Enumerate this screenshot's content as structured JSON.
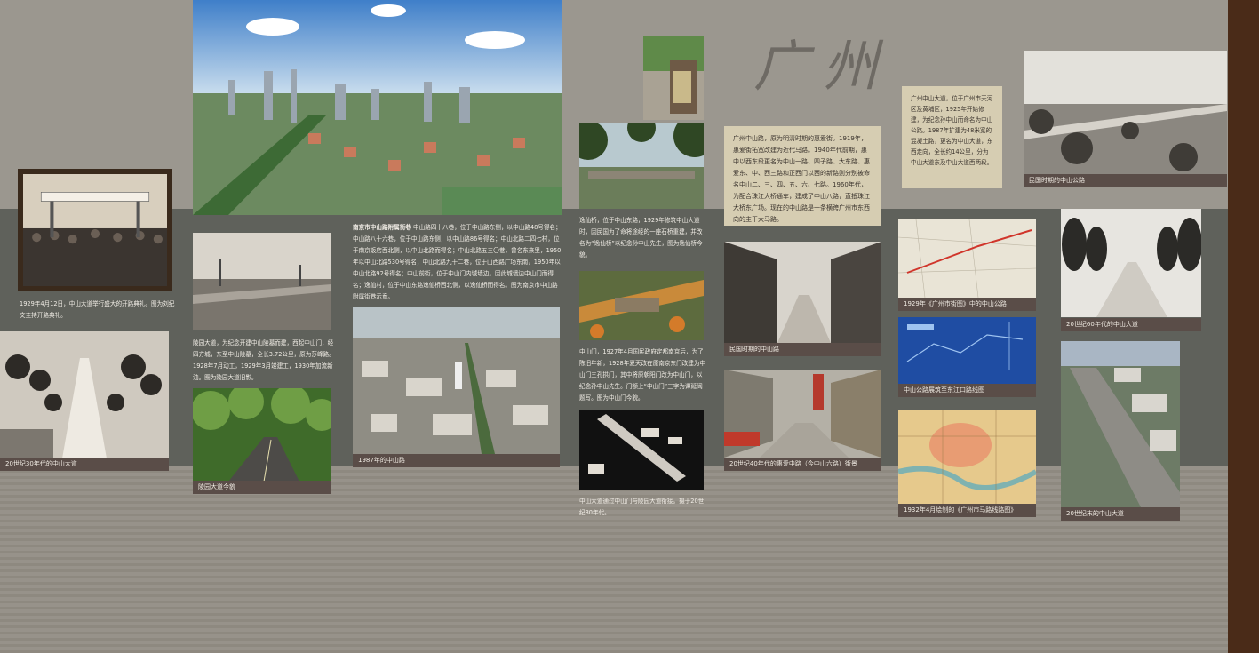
{
  "title": "广州",
  "captions": {
    "c1929": "1929年4月12日，中山大道举行盛大的开路典礼。图为刘纪文主持开路典礼。",
    "c20s30": "20世纪30年代的中山大道",
    "lingyuan": "陵园大道今貌",
    "c1987": "1987年的中山路",
    "c1930s_note": "中山大道通过中山门与陵园大道衔接。摄于20世纪30年代。",
    "minguo_zs": "民国时期的中山路",
    "huiaiton": "20世纪40年代的惠爱中路（今中山六路）街景",
    "map1929": "1929年《广州市街图》中的中山公路",
    "blueprint": "中山公路展筑至东江口路线图",
    "map1932": "1932年4月绘制的《广州市马路线路图》",
    "minguo_gl": "民国时期的中山公路",
    "c60s": "20世纪60年代的中山大道",
    "c_end": "20世纪末的中山大道"
  },
  "texts": {
    "nanjing_title": "南京市中山路附属街巷",
    "nanjing_body": "中山路四十八巷，位于中山路东侧，以中山路48号得名；中山路八十六巷，位于中山路东侧，以中山路86号得名；中山北路二四七村，位于南京饭店西北侧，以中山北路而得名；中山北路五三〇巷，曾名东来里，1950年以中山北路530号得名；中山北路九十二巷，位于山西路广场东南，1950年以中山北路92号得名；中山前街，位于中山门内城墙边，因此城墙边中山门而得名；逸仙村，位于中山东路逸仙桥西北侧，以逸仙桥而得名。图为南京市中山路附属街巷示意。",
    "lingyuan_body": "陵园大道，为纪念开建中山陵墓而建，西起中山门，经四方城，东至中山陵墓，全长3.72公里，原为莎峰路。1928年7月动工，1929年3月竣建工，1930年加流新油。图为陵园大道旧影。",
    "yixian_body": "逸仙桥，位于中山东路，1929年修筑中山大道时，因民国为了命将途经的一座石桥重建，并改名为“逸仙桥”以纪念孙中山先生，图为逸仙桥今貌。",
    "zhongshanmen_body": "中山门，1927年4月国民政府定都南京后，为了陈旧年新，1928年夏天改在原南京东门改建为中山门三孔拱门，其中将原朝阳门改为中山门，以纪念孙中山先生。门额上“中山门”三字为谭延闿题写。图为中山门今貌。",
    "gz_zhongshan": "广州中山路，原为明清时期的惠爱街。1919年，惠爱街拓宽改建为近代马路。1940年代前期，惠中以西东段更名为中山一路、四子路、大东路、惠爱东、中、西三路和正西门以西的新路则分别被命名中山二、三、四、五、六、七路。1960年代，为配合珠江大桥通车，建成了中山八路，直抵珠江大桥东广场。现在的中山路是一条横跨广州市东西向的主干大马路。",
    "gz_dadao": "广州中山大道，位于广州市天河区及黄埔区，1925年开始修建，为纪念孙中山而命名为中山公路。1987年扩建为48米宽的混凝土路，更名为中山大道，东西走向，全长约14公里，分为中山大道东及中山大道西两段。"
  },
  "colors": {
    "caption_bg": "#5a4d48",
    "mid_band": "#5f615b",
    "right_strip": "#4a2b18",
    "note_box": "#d6cdb2"
  }
}
